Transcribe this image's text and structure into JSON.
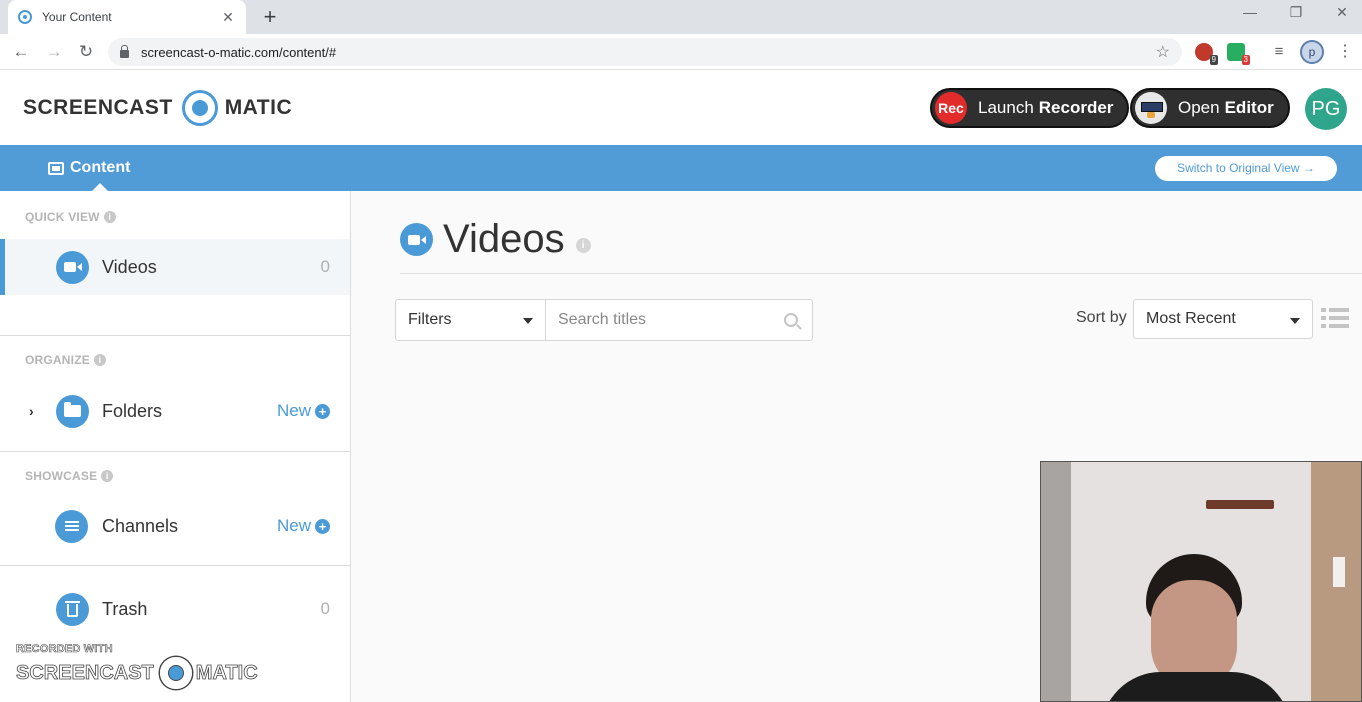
{
  "browser": {
    "tab_title": "Your Content",
    "url": "screencast-o-matic.com/content/#",
    "extensions": [
      {
        "name": "adblock-icon",
        "badge": "9",
        "color": "#c0392b"
      },
      {
        "name": "shield-icon",
        "badge": "3",
        "color": "#27ae60"
      }
    ],
    "profile_initial": "p"
  },
  "header": {
    "logo_left": "SCREENCAST",
    "logo_right": "MATIC",
    "launch_recorder": {
      "icon_text": "Rec",
      "label_a": "Launch",
      "label_b": "Recorder"
    },
    "open_editor": {
      "label_a": "Open",
      "label_b": "Editor"
    },
    "user_initials": "PG"
  },
  "navbar": {
    "content_label": "Content",
    "switch_label": "Switch to Original View →"
  },
  "sidebar": {
    "quick_view_label": "QUICK VIEW",
    "organize_label": "ORGANIZE",
    "showcase_label": "SHOWCASE",
    "videos": {
      "label": "Videos",
      "count": "0"
    },
    "folders": {
      "label": "Folders",
      "new_label": "New"
    },
    "channels": {
      "label": "Channels",
      "new_label": "New"
    },
    "trash": {
      "label": "Trash",
      "count": "0"
    }
  },
  "main": {
    "title": "Videos",
    "filters_label": "Filters",
    "search_placeholder": "Search titles",
    "sort_by_label": "Sort by",
    "sort_value": "Most Recent"
  },
  "watermark": {
    "line1": "RECORDED WITH",
    "left": "SCREENCAST",
    "right": "MATIC"
  },
  "colors": {
    "brand_blue": "#4a9ad8",
    "navbar_blue": "#519bd6",
    "rec_red": "#e22b2b",
    "avatar_green": "#2fa58b"
  }
}
